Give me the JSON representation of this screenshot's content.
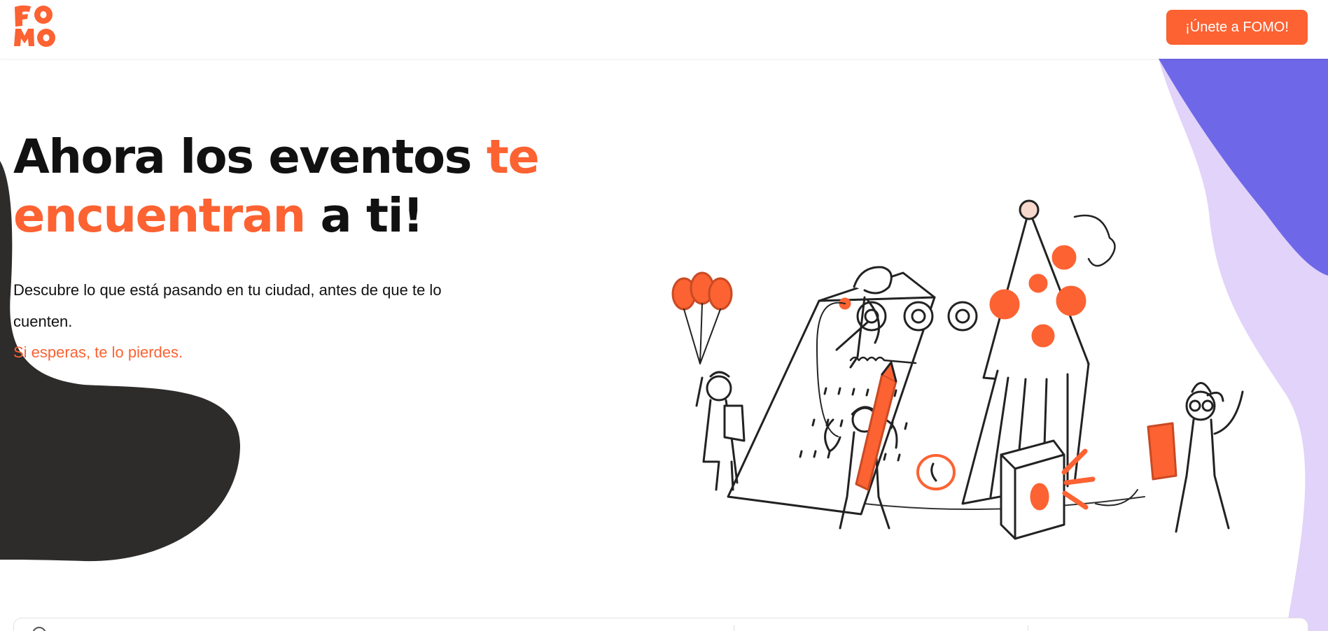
{
  "header": {
    "logo_alt": "FOMO",
    "join_button_label": "¡Únete a FOMO!"
  },
  "hero": {
    "headline_part1": "Ahora los eventos ",
    "headline_highlight1": "te",
    "headline_highlight2": "encuentran",
    "headline_part2": " a ti!",
    "description": "Descubre lo que está pasando en tu ciudad, antes de que te lo cuenten.",
    "tagline": "Si esperas, te lo pierdes."
  },
  "colors": {
    "accent": "#fc6232",
    "purple": "#6e68e8",
    "lavender": "#e2d3fa",
    "dark": "#2e2b2b"
  },
  "icons": [
    "fomo-logo",
    "search-icon"
  ]
}
